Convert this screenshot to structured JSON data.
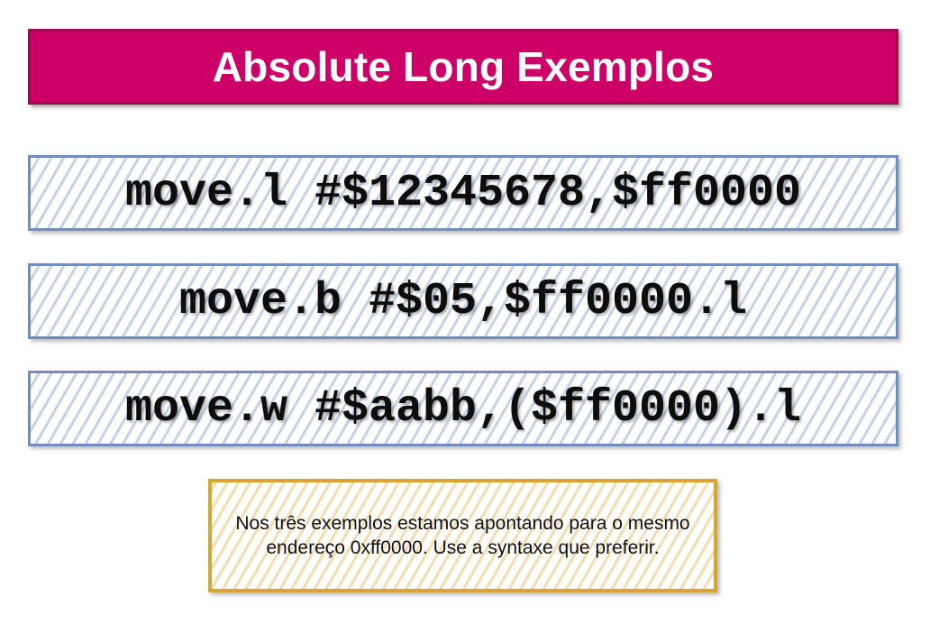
{
  "title": "Absolute Long Exemplos",
  "examples": [
    {
      "code": "move.l #$12345678,$ff0000"
    },
    {
      "code": "move.b #$05,$ff0000.l"
    },
    {
      "code": "move.w #$aabb,($ff0000).l"
    }
  ],
  "note": {
    "text": "Nos três exemplos estamos apontando para o mesmo endereço 0xff0000. Use a syntaxe que preferir."
  },
  "colors": {
    "title_background": "#cc0066",
    "title_border": "#9e0b4c",
    "code_border": "#6f8fbf",
    "note_border": "#d6a632"
  }
}
